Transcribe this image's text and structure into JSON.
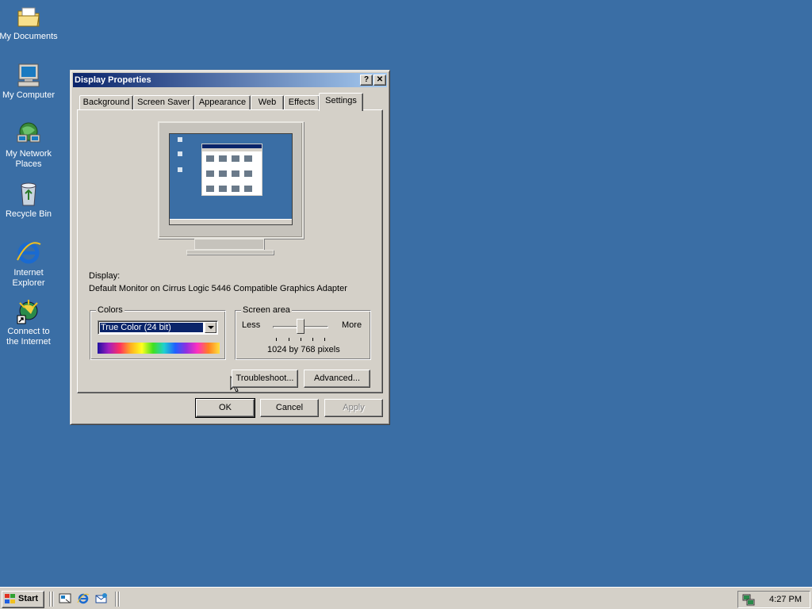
{
  "desktop": {
    "background": "#3a6ea5",
    "icons": [
      {
        "label": "My Documents",
        "icon": "folder-documents-icon"
      },
      {
        "label": "My Computer",
        "icon": "computer-icon"
      },
      {
        "label_line1": "My Network",
        "label_line2": "Places",
        "icon": "network-places-icon"
      },
      {
        "label": "Recycle Bin",
        "icon": "recycle-bin-icon"
      },
      {
        "label_line1": "Internet",
        "label_line2": "Explorer",
        "icon": "internet-explorer-icon"
      },
      {
        "label_line1": "Connect to",
        "label_line2": "the Internet",
        "icon": "connect-internet-icon"
      }
    ]
  },
  "dialog": {
    "title": "Display Properties",
    "help_button": "?",
    "close_button": "✕",
    "tabs": [
      {
        "label": "Background"
      },
      {
        "label": "Screen Saver"
      },
      {
        "label": "Appearance"
      },
      {
        "label": "Web"
      },
      {
        "label": "Effects"
      },
      {
        "label": "Settings",
        "active": true
      }
    ],
    "display_label": "Display:",
    "display_value": "Default Monitor on Cirrus Logic 5446 Compatible Graphics Adapter",
    "colors": {
      "group_label": "Colors",
      "selected": "True Color (24 bit)"
    },
    "screen_area": {
      "group_label": "Screen area",
      "less": "Less",
      "more": "More",
      "value_text": "1024 by 768 pixels",
      "slider_fraction": 0.5
    },
    "buttons": {
      "troubleshoot": "Troubleshoot...",
      "advanced": "Advanced...",
      "ok": "OK",
      "cancel": "Cancel",
      "apply": "Apply"
    }
  },
  "taskbar": {
    "start_label": "Start",
    "quick_launch": [
      "show-desktop-icon",
      "internet-explorer-icon",
      "outlook-express-icon"
    ],
    "clock": "4:27 PM",
    "tray_icon": "network-tray-icon"
  }
}
